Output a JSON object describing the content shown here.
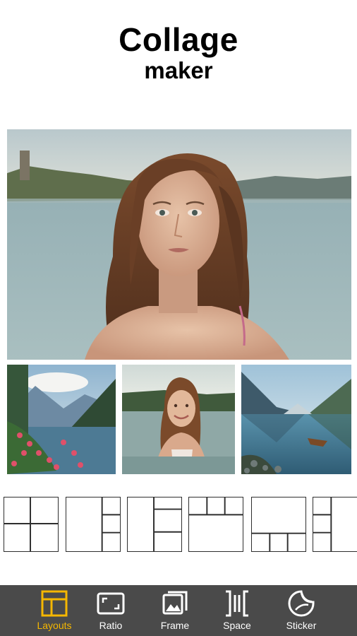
{
  "header": {
    "title": "Collage",
    "subtitle": "maker"
  },
  "photos": {
    "main": {
      "subject": "woman-portrait-lake"
    },
    "small": [
      {
        "subject": "lake-mountains-red-flowers"
      },
      {
        "subject": "smiling-woman-in-lake"
      },
      {
        "subject": "mountain-lake-boat"
      }
    ]
  },
  "layouts": [
    {
      "name": "grid-2x2"
    },
    {
      "name": "left-large-right-3"
    },
    {
      "name": "left-tall-right-stack"
    },
    {
      "name": "top-3-bottom-large"
    },
    {
      "name": "top-large-bottom-3"
    },
    {
      "name": "left-stack-right-large"
    }
  ],
  "toolbar": {
    "accent_color": "#f5b700",
    "active": "Layouts",
    "items": [
      {
        "label": "Layouts",
        "icon": "layouts-icon"
      },
      {
        "label": "Ratio",
        "icon": "ratio-icon"
      },
      {
        "label": "Frame",
        "icon": "frame-icon"
      },
      {
        "label": "Space",
        "icon": "space-icon"
      },
      {
        "label": "Sticker",
        "icon": "sticker-icon"
      }
    ]
  }
}
